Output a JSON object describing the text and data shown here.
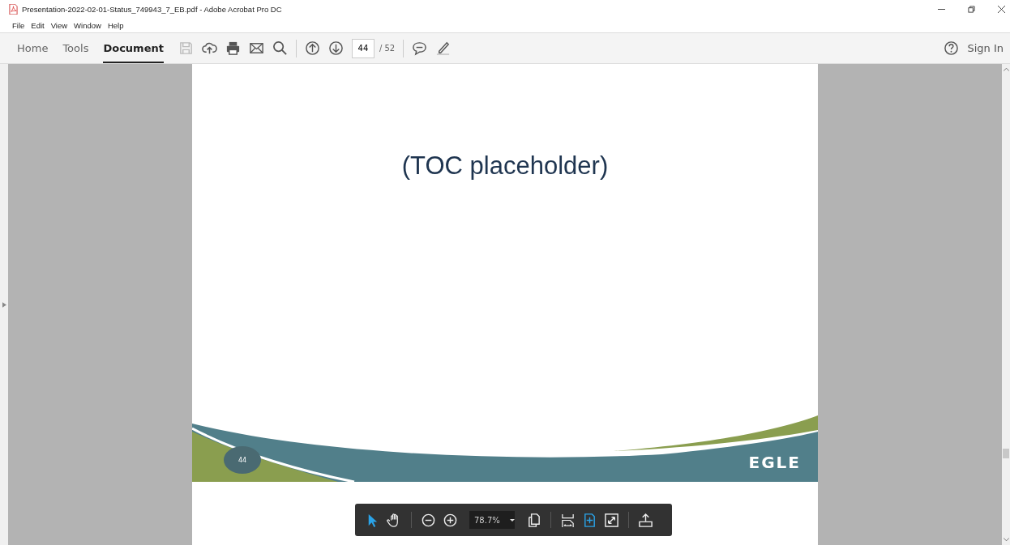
{
  "window": {
    "title": "Presentation-2022-02-01-Status_749943_7_EB.pdf - Adobe Acrobat Pro DC"
  },
  "menu": [
    "File",
    "Edit",
    "View",
    "Window",
    "Help"
  ],
  "tabs": [
    {
      "label": "Home",
      "selected": false
    },
    {
      "label": "Tools",
      "selected": false
    },
    {
      "label": "Document",
      "selected": true
    }
  ],
  "toolbar": {
    "page": "44",
    "page_total": "/ 52",
    "sign_in": "Sign In"
  },
  "slide": {
    "title": "(TOC placeholder)",
    "page_number": "44",
    "logo": "EGLE"
  },
  "floating_toolbar": {
    "zoom": "78.7%",
    "tools": [
      {
        "kind": "select",
        "selected": true
      },
      {
        "kind": "hand",
        "selected": false
      },
      {
        "kind": "fit-page",
        "selected": true
      },
      {
        "kind": "full-screen",
        "selected": false
      }
    ]
  }
}
